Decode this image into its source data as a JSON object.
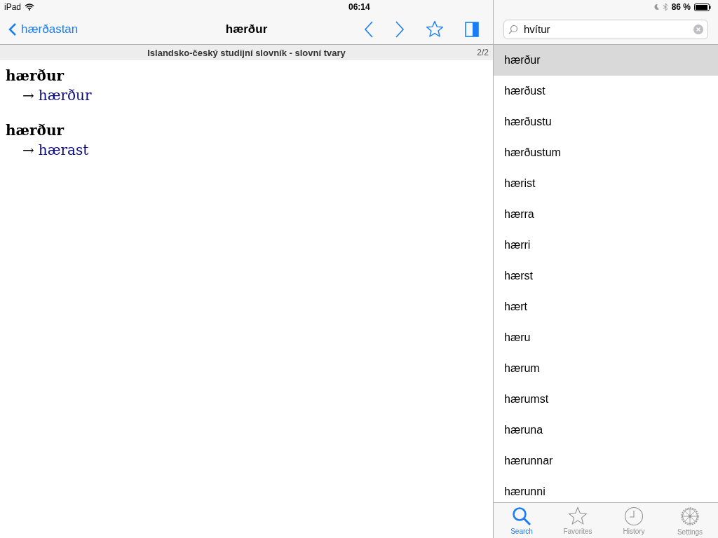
{
  "status_bar": {
    "device": "iPad",
    "time": "06:14",
    "battery": "86 %"
  },
  "nav_bar": {
    "back": "hærðastan",
    "title": "hærður"
  },
  "dictionary": {
    "name": "Islandsko-český studijní slovník - slovní tvary",
    "page": "2/2"
  },
  "entries": [
    {
      "headword": "hærður",
      "arrow": "→",
      "target": "hærður"
    },
    {
      "headword": "hærður",
      "arrow": "→",
      "target": "hærast"
    }
  ],
  "search": {
    "value": "hvítur"
  },
  "results": [
    {
      "label": "hærður",
      "selected": true
    },
    {
      "label": "hærðust",
      "selected": false
    },
    {
      "label": "hærðustu",
      "selected": false
    },
    {
      "label": "hærðustum",
      "selected": false
    },
    {
      "label": "hærist",
      "selected": false
    },
    {
      "label": "hærra",
      "selected": false
    },
    {
      "label": "hærri",
      "selected": false
    },
    {
      "label": "hærst",
      "selected": false
    },
    {
      "label": "hært",
      "selected": false
    },
    {
      "label": "hæru",
      "selected": false
    },
    {
      "label": "hærum",
      "selected": false
    },
    {
      "label": "hærumst",
      "selected": false
    },
    {
      "label": "hæruna",
      "selected": false
    },
    {
      "label": "hærunnar",
      "selected": false
    },
    {
      "label": "hærunni",
      "selected": false
    }
  ],
  "tab_bar": [
    {
      "kind": "search",
      "label": "Search",
      "selected": true
    },
    {
      "kind": "favorites",
      "label": "Favorites",
      "selected": false
    },
    {
      "kind": "history",
      "label": "History",
      "selected": false
    },
    {
      "kind": "settings",
      "label": "Settings",
      "selected": false
    }
  ]
}
